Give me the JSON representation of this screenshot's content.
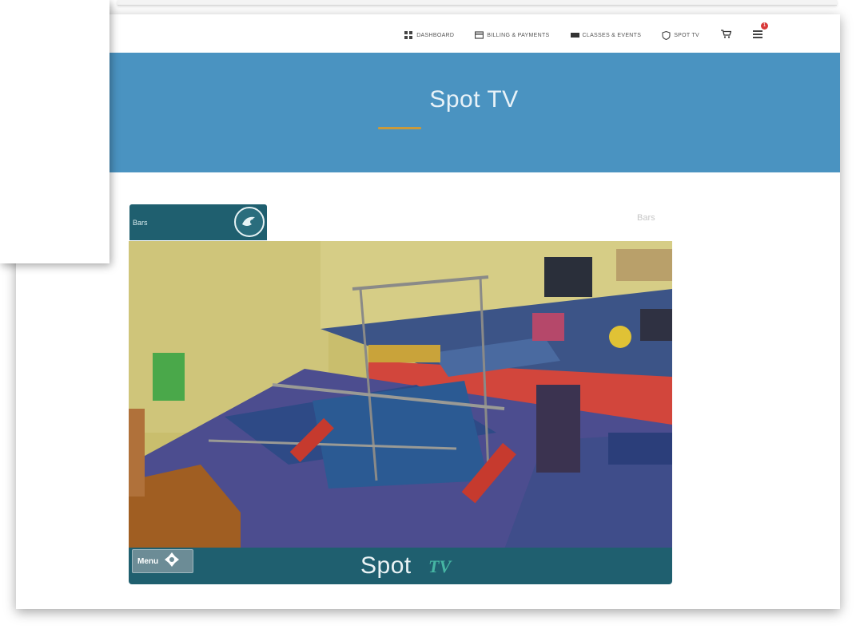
{
  "nav": {
    "items": [
      {
        "label": "Dashboard",
        "icon": "grid-icon"
      },
      {
        "label": "Billing & Payments",
        "icon": "card-icon"
      },
      {
        "label": "Classes & Events",
        "icon": "ticket-icon"
      },
      {
        "label": "Spot TV",
        "icon": "shield-icon"
      }
    ],
    "cart_icon": "cart-icon",
    "menu_icon": "hamburger-icon",
    "menu_badge": "1"
  },
  "banner": {
    "title": "Spot TV"
  },
  "camera": {
    "tab_label": "Bars",
    "name_right": "Bars",
    "menu_label": "Menu",
    "brand_spot": "Spot",
    "brand_tv": "TV"
  },
  "colors": {
    "banner": "#4a93c1",
    "accent_underline": "#c99a3b",
    "camera_bar": "#1f5f6f",
    "badge": "#d93a3a"
  }
}
